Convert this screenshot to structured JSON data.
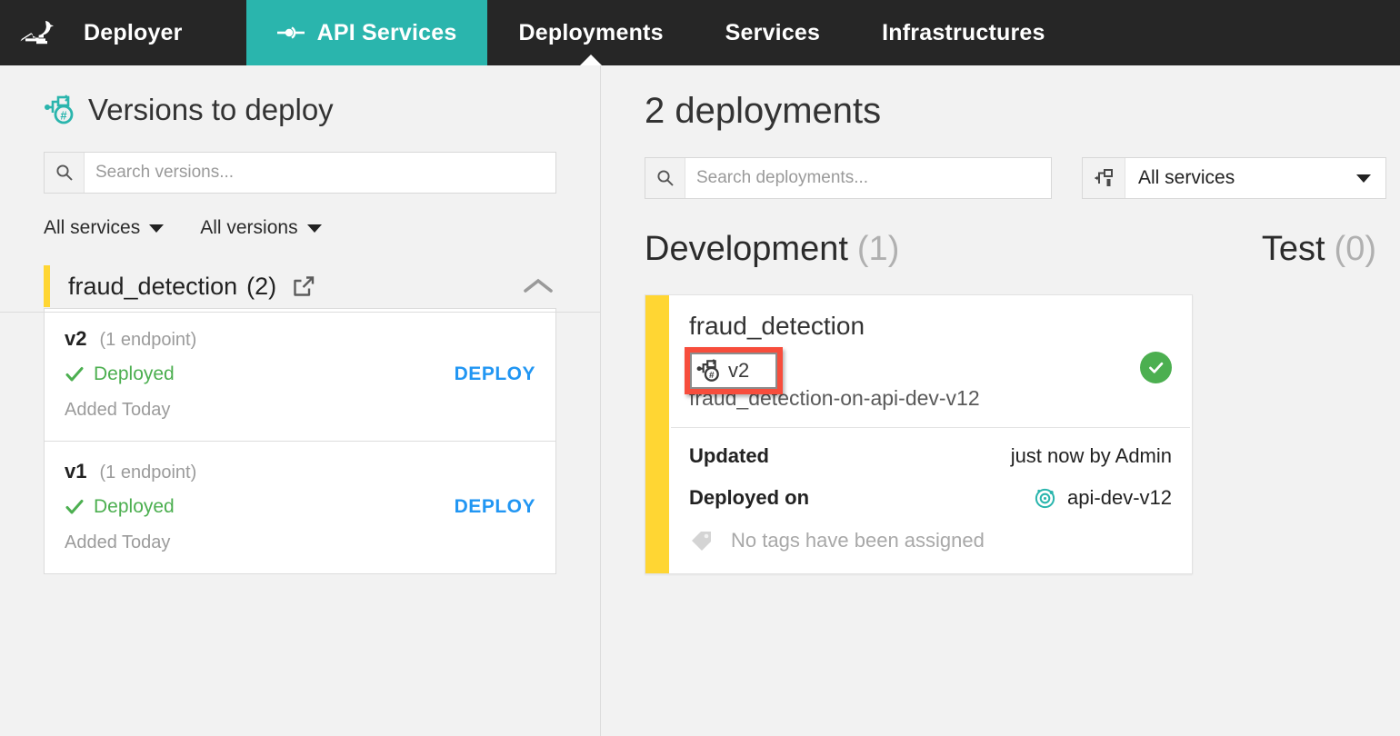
{
  "nav": {
    "logo_icon": "bird-logo-icon",
    "brand": "Deployer",
    "items": [
      {
        "label": "API Services",
        "icon": "api-endpoint-icon",
        "active": true
      },
      {
        "label": "Deployments",
        "current": true
      },
      {
        "label": "Services"
      },
      {
        "label": "Infrastructures"
      }
    ]
  },
  "left_panel": {
    "title": "Versions to deploy",
    "title_icon": "version-hash-icon",
    "search": {
      "placeholder": "Search versions...",
      "value": "",
      "icon": "search-icon"
    },
    "filters": [
      {
        "label": "All services"
      },
      {
        "label": "All versions"
      }
    ],
    "group": {
      "name": "fraud_detection",
      "count": "(2)",
      "external_icon": "external-link-icon",
      "collapse_icon": "chevron-up-icon",
      "accent_color": "#ffd633",
      "versions": [
        {
          "name": "v2",
          "endpoints": "(1 endpoint)",
          "status": "Deployed",
          "status_icon": "check-icon",
          "status_color": "#4caf50",
          "action": "DEPLOY",
          "added": "Added Today"
        },
        {
          "name": "v1",
          "endpoints": "(1 endpoint)",
          "status": "Deployed",
          "status_icon": "check-icon",
          "status_color": "#4caf50",
          "action": "DEPLOY",
          "added": "Added Today"
        }
      ]
    }
  },
  "right_panel": {
    "title": "2 deployments",
    "search": {
      "placeholder": "Search deployments...",
      "value": "",
      "icon": "search-icon"
    },
    "service_filter": {
      "value": "All services",
      "icon": "filter-services-icon"
    },
    "environments": [
      {
        "name": "Development",
        "count": "(1)"
      },
      {
        "name": "Test",
        "count": "(0)"
      }
    ],
    "deployment": {
      "name": "fraud_detection",
      "version": "v2",
      "version_icon": "version-hash-icon",
      "deployment_id": "fraud_detection-on-api-dev-v12",
      "accent_color": "#ffd633",
      "status_icon": "check-circle-icon",
      "status_color": "#4caf50",
      "meta": [
        {
          "key": "Updated",
          "value": "just now by Admin",
          "icon": null
        },
        {
          "key": "Deployed on",
          "value": "api-dev-v12",
          "icon": "infrastructure-target-icon"
        }
      ],
      "tags": {
        "icon": "tag-icon",
        "text": "No tags have been assigned"
      }
    }
  },
  "annotation": {
    "highlight_color": "#f74d3c",
    "target": "v2",
    "target_icon": "version-hash-icon"
  }
}
